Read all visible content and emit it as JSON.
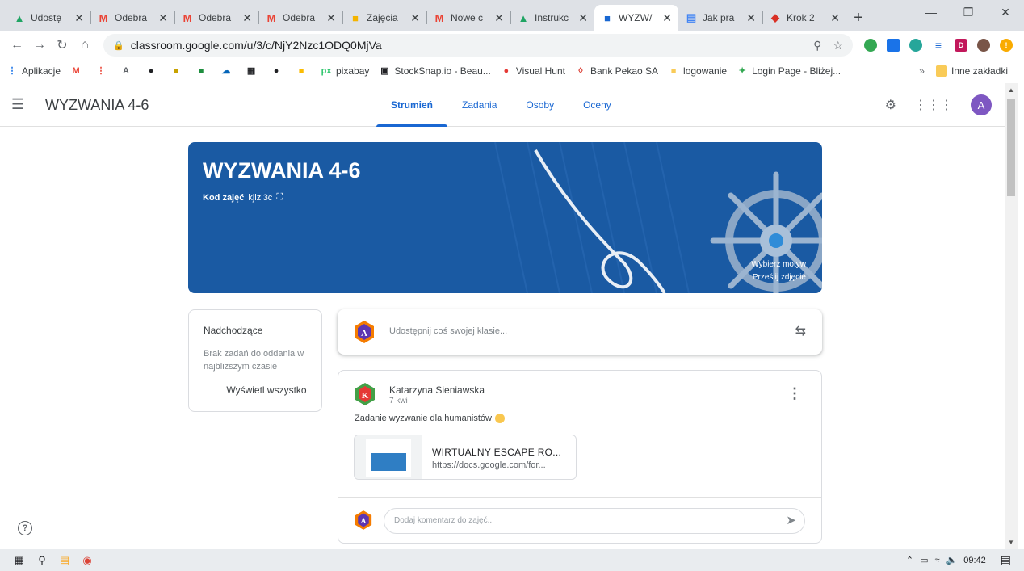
{
  "browser": {
    "tabs": [
      {
        "label": "Udostę",
        "icon": "drive-icon",
        "color": "#1fa463"
      },
      {
        "label": "Odebra",
        "icon": "gmail-icon",
        "color": "#ea4335"
      },
      {
        "label": "Odebra",
        "icon": "gmail-icon",
        "color": "#ea4335"
      },
      {
        "label": "Odebra",
        "icon": "gmail-icon",
        "color": "#ea4335"
      },
      {
        "label": "Zajęcia",
        "icon": "classroom-icon",
        "color": "#f4b400"
      },
      {
        "label": "Nowe c",
        "icon": "gmail-icon",
        "color": "#ea4335"
      },
      {
        "label": "Instrukc",
        "icon": "drive-icon",
        "color": "#1fa463"
      },
      {
        "label": "WYZW/",
        "icon": "classroom-icon",
        "color": "#1967d2",
        "active": true
      },
      {
        "label": "Jak pra",
        "icon": "docs-icon",
        "color": "#4285f4"
      },
      {
        "label": "Krok 2",
        "icon": "red-cube-icon",
        "color": "#d93025"
      }
    ],
    "url": "classroom.google.com/u/3/c/NjY2Nzc1ODQ0MjVa",
    "bookmarks": [
      {
        "label": "Aplikacje",
        "icon": "apps-icon"
      },
      {
        "label": "",
        "icon": "gmail-icon"
      },
      {
        "label": "",
        "icon": "dots-icon"
      },
      {
        "label": "",
        "icon": "adobe-icon"
      },
      {
        "label": "",
        "icon": "apple-icon"
      },
      {
        "label": "",
        "icon": "game-icon"
      },
      {
        "label": "",
        "icon": "green-icon"
      },
      {
        "label": "",
        "icon": "cloud-icon"
      },
      {
        "label": "",
        "icon": "grid-icon"
      },
      {
        "label": "",
        "icon": "spotify-icon"
      },
      {
        "label": "",
        "icon": "keep-icon"
      },
      {
        "label": "pixabay",
        "icon": "pixabay-icon"
      },
      {
        "label": "StockSnap.io - Beau...",
        "icon": "camera-icon"
      },
      {
        "label": "Visual Hunt",
        "icon": "visualhunt-icon"
      },
      {
        "label": "Bank Pekao SA",
        "icon": "bank-icon"
      },
      {
        "label": "logowanie",
        "icon": "folder-icon"
      },
      {
        "label": "Login Page - Bliżej...",
        "icon": "login-icon"
      }
    ],
    "bookmarks_more": "»",
    "other_bookmarks": "Inne zakładki"
  },
  "classroom": {
    "class_name": "WYZWANIA 4-6",
    "nav_tabs": [
      {
        "label": "Strumień",
        "active": true
      },
      {
        "label": "Zadania"
      },
      {
        "label": "Osoby"
      },
      {
        "label": "Oceny"
      }
    ],
    "user_initial": "A",
    "banner": {
      "title": "WYZWANIA 4-6",
      "code_label": "Kod zajęć",
      "code_value": "kjizi3c",
      "select_theme": "Wybierz motyw",
      "upload_photo": "Prześlij zdjęcie"
    },
    "upcoming": {
      "title": "Nadchodzące",
      "empty_text": "Brak zadań do oddania w najbliższym czasie",
      "view_all": "Wyświetl wszystko"
    },
    "share_placeholder": "Udostępnij coś swojej klasie...",
    "post": {
      "author": "Katarzyna Sieniawska",
      "date": "7 kwi",
      "text": "Zadanie wyzwanie dla humanistów",
      "author_initial": "K",
      "attachment": {
        "title": "WIRTUALNY ESCAPE RO...",
        "url": "https://docs.google.com/for..."
      },
      "comment_placeholder": "Dodaj komentarz do zajęć..."
    }
  },
  "taskbar": {
    "time": "09:42"
  },
  "colors": {
    "banner": "#1a5aa3",
    "accent": "#1967d2"
  }
}
